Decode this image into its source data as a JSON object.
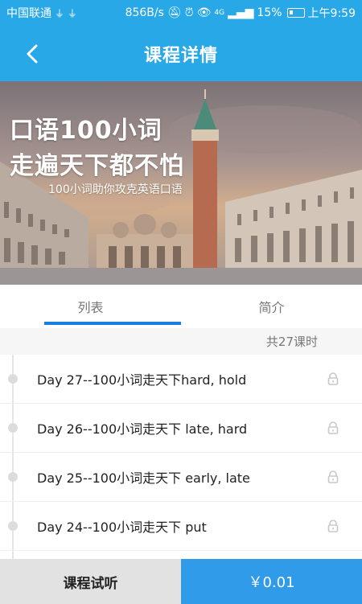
{
  "status_bar": {
    "carrier": "中国联通",
    "usb_icons": "⚲ ⚲",
    "speed": "856B/s",
    "signal_label": "4G",
    "battery_percent": "15%",
    "time": "上午9:59"
  },
  "app_bar": {
    "title": "课程详情",
    "back_icon": "chevron-left-icon"
  },
  "banner": {
    "line1": "口语100小词",
    "line2": "走遍天下都不怕",
    "subtitle": "100小词助你攻克英语口语"
  },
  "tabs": [
    {
      "label": "列表",
      "active": true
    },
    {
      "label": "简介",
      "active": false
    }
  ],
  "course_count": "共27课时",
  "lessons": [
    {
      "title": "Day 27--100小词走天下hard, hold",
      "locked": true
    },
    {
      "title": "Day 26--100小词走天下 late, hard",
      "locked": true
    },
    {
      "title": "Day 25--100小词走天下 early, late",
      "locked": true
    },
    {
      "title": "Day 24--100小词走天下 put",
      "locked": true
    }
  ],
  "bottom_bar": {
    "trial_label": "课程试听",
    "price_label": "￥0.01"
  },
  "colors": {
    "header": "#29a8e8",
    "accent": "#1a7ee0",
    "buy_button": "#2f9be9",
    "trial_button": "#e2e2e2"
  }
}
